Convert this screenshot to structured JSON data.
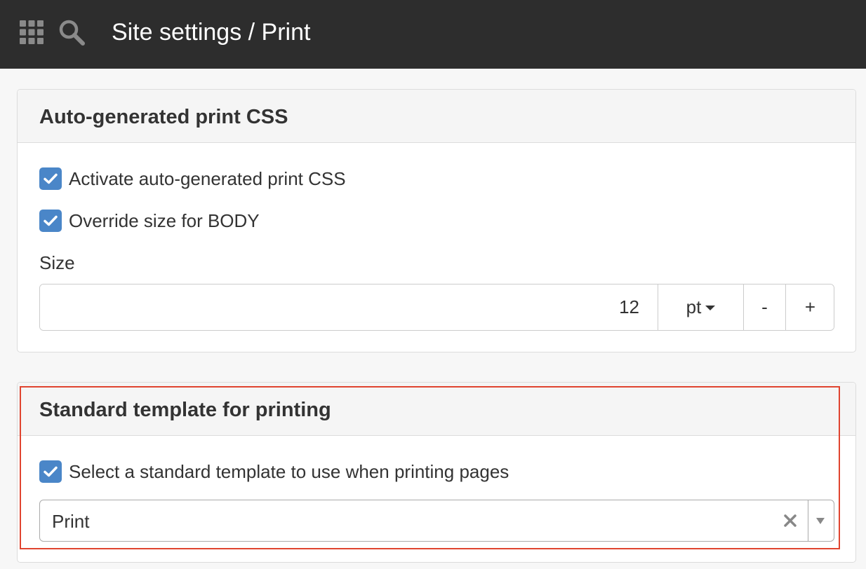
{
  "header": {
    "title": "Site settings / Print",
    "icons": {
      "apps": "grid-icon",
      "search": "search-icon"
    }
  },
  "print_css": {
    "title": "Auto-generated print CSS",
    "activate": {
      "label": "Activate auto-generated print CSS",
      "checked": true
    },
    "override": {
      "label": "Override size for BODY",
      "checked": true
    },
    "size": {
      "label": "Size",
      "value": "12",
      "unit": "pt",
      "minus": "-",
      "plus": "+"
    }
  },
  "template": {
    "title": "Standard template for printing",
    "select_checkbox": {
      "label": "Select a standard template to use when printing pages",
      "checked": true
    },
    "selected": "Print",
    "clear_symbol": "×"
  },
  "colors": {
    "topbar": "#2d2d2d",
    "checkbox": "#4a86c8",
    "highlight": "#e0442f"
  }
}
